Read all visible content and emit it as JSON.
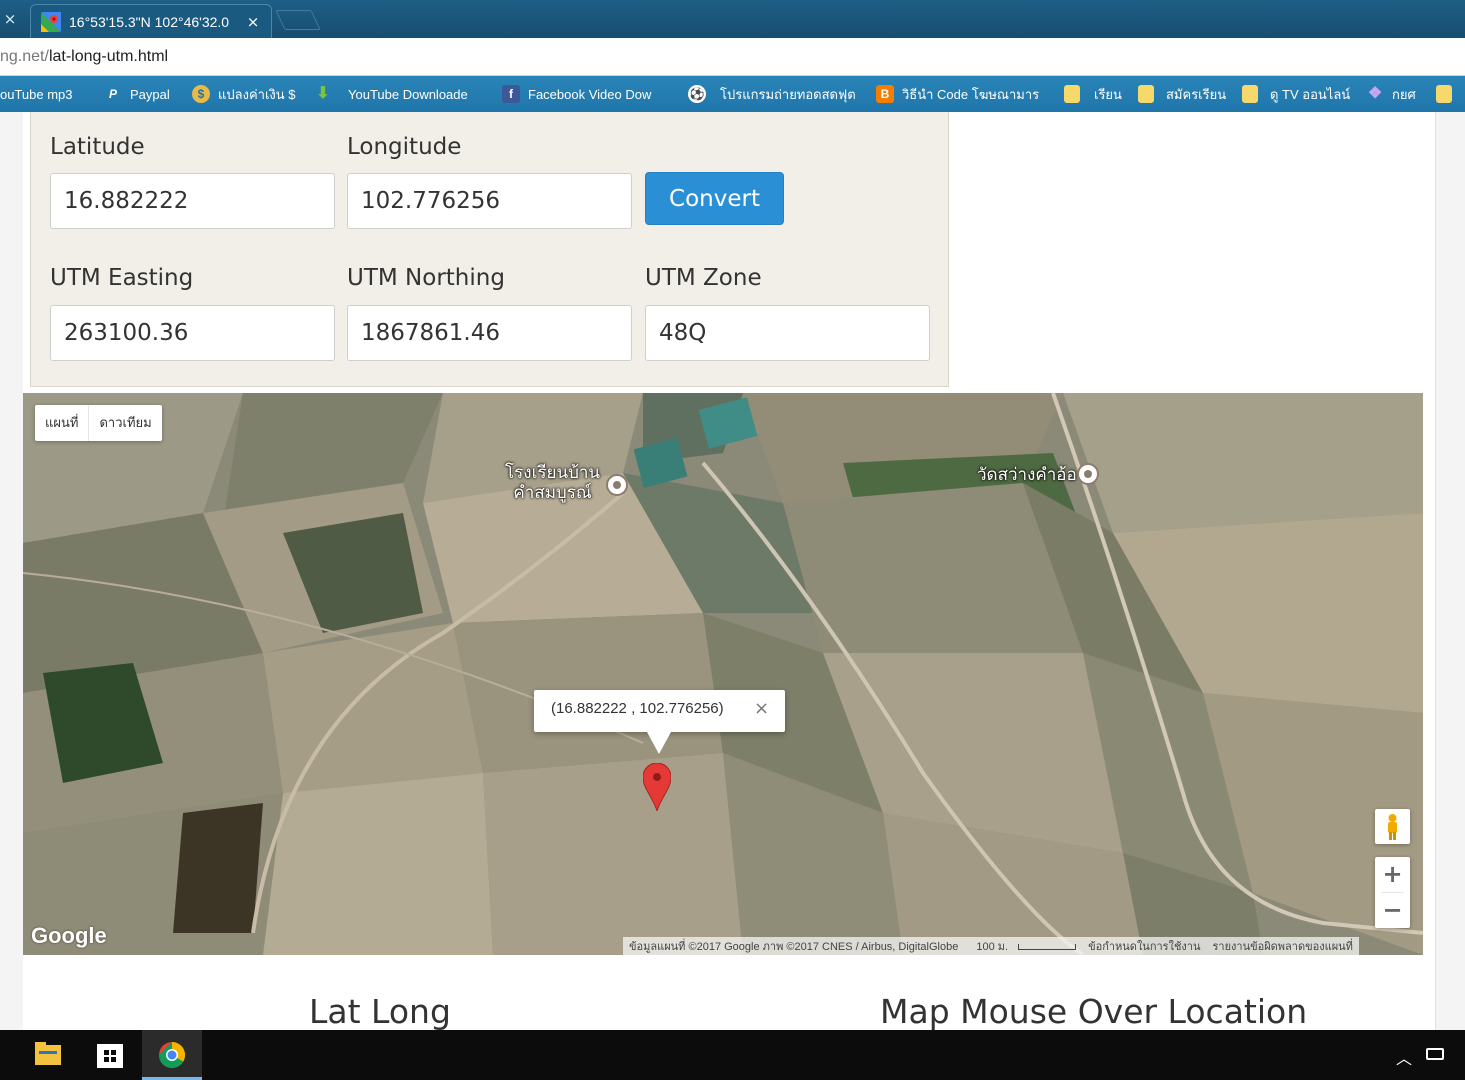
{
  "browser": {
    "tab_close_left": "×",
    "tab_title": "16°53'15.3\"N 102°46'32.0",
    "tab_close": "×",
    "url_dim": "ng.net/",
    "url_path": "lat-long-utm.html"
  },
  "bookmarks": [
    {
      "label": "ouTube mp3",
      "icon": "youtube-mp3-icon",
      "color": "#2a84b8"
    },
    {
      "label": "Paypal",
      "icon": "paypal-icon",
      "color": "#ffffff"
    },
    {
      "label": "แปลงค่าเงิน $",
      "icon": "currency-icon",
      "color": "#e9b949"
    },
    {
      "label": "YouTube Downloade",
      "icon": "download-arrow-icon",
      "color": "#7cc242"
    },
    {
      "label": "Facebook Video Dow",
      "icon": "facebook-icon",
      "color": "#3b5998"
    },
    {
      "label": "โปรแกรมถ่ายทอดสดฟุต",
      "icon": "football-icon",
      "color": "#ffffff"
    },
    {
      "label": "วิธีนำ Code โฆษณามาร",
      "icon": "blogger-icon",
      "color": "#f57d00"
    },
    {
      "label": "เรียน",
      "icon": "folder-icon",
      "color": "#f6d86b"
    },
    {
      "label": "สมัครเรียน",
      "icon": "folder-icon",
      "color": "#f6d86b"
    },
    {
      "label": "ดู TV ออนไลน์",
      "icon": "folder-icon",
      "color": "#f6d86b"
    },
    {
      "label": "กยศ",
      "icon": "diamond-icon",
      "color": "#a77bd6"
    },
    {
      "label": "",
      "icon": "folder-icon",
      "color": "#f6d86b"
    }
  ],
  "form": {
    "latitude_label": "Latitude",
    "latitude_value": "16.882222",
    "longitude_label": "Longitude",
    "longitude_value": "102.776256",
    "convert_label": "Convert",
    "easting_label": "UTM Easting",
    "easting_value": "263100.36",
    "northing_label": "UTM Northing",
    "northing_value": "1867861.46",
    "zone_label": "UTM Zone",
    "zone_value": "48Q"
  },
  "map": {
    "type_map": "แผนที่",
    "type_satellite": "ดาวเทียม",
    "label_school_line1": "โรงเรียนบ้าน",
    "label_school_line2": "คำสมบูรณ์",
    "label_temple": "วัดสว่างคำอ้อ",
    "info_text": "(16.882222 , 102.776256)",
    "info_close": "×",
    "zoom_in": "+",
    "zoom_out": "−",
    "google": "Google",
    "attribution": "ข้อมูลแผนที่ ©2017 Google ภาพ ©2017 CNES / Airbus, DigitalGlobe",
    "scale": "100 ม.",
    "terms": "ข้อกำหนดในการใช้งาน",
    "report": "รายงานข้อผิดพลาดของแผนที่"
  },
  "sections": {
    "lat_long": "Lat Long",
    "mouse_over": "Map Mouse Over Location"
  },
  "colors": {
    "accent": "#2b8fd6",
    "panel": "#f1efe7",
    "marker": "#e53935"
  }
}
